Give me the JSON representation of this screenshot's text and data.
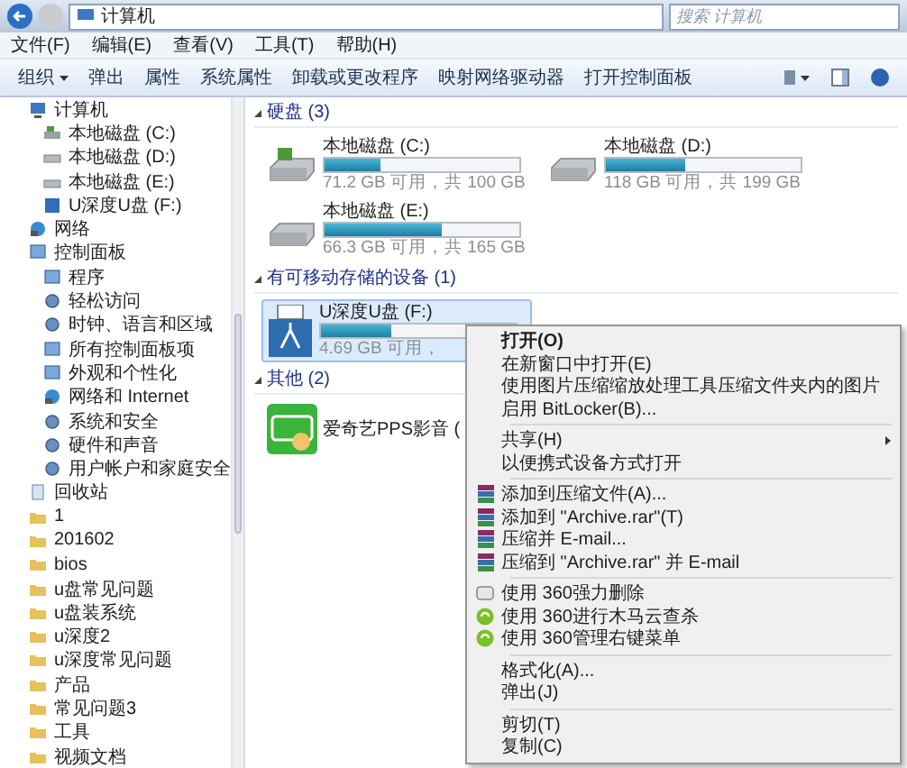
{
  "address": {
    "path": [
      "计算机"
    ],
    "search_placeholder": "搜索 计算机"
  },
  "menu": [
    "文件(F)",
    "编辑(E)",
    "查看(V)",
    "工具(T)",
    "帮助(H)"
  ],
  "toolbar": [
    {
      "label": "组织",
      "dropdown": true
    },
    {
      "label": "弹出",
      "dropdown": false
    },
    {
      "label": "属性",
      "dropdown": false
    },
    {
      "label": "系统属性",
      "dropdown": false
    },
    {
      "label": "卸载或更改程序",
      "dropdown": false
    },
    {
      "label": "映射网络驱动器",
      "dropdown": false
    },
    {
      "label": "打开控制面板",
      "dropdown": false
    }
  ],
  "sidebar": [
    {
      "label": "计算机",
      "kind": "computer",
      "children": [
        {
          "label": "本地磁盘 (C:)",
          "kind": "system-drive"
        },
        {
          "label": "本地磁盘 (D:)",
          "kind": "drive"
        },
        {
          "label": "本地磁盘 (E:)",
          "kind": "drive"
        },
        {
          "label": "U深度U盘 (F:)",
          "kind": "usb"
        }
      ]
    },
    {
      "label": "网络",
      "kind": "network"
    },
    {
      "label": "控制面板",
      "kind": "panel",
      "children": [
        {
          "label": "程序",
          "kind": "panel"
        },
        {
          "label": "轻松访问",
          "kind": "setting"
        },
        {
          "label": "时钟、语言和区域",
          "kind": "setting"
        },
        {
          "label": "所有控制面板项",
          "kind": "panel"
        },
        {
          "label": "外观和个性化",
          "kind": "panel"
        },
        {
          "label": "网络和 Internet",
          "kind": "network"
        },
        {
          "label": "系统和安全",
          "kind": "setting"
        },
        {
          "label": "硬件和声音",
          "kind": "setting"
        },
        {
          "label": "用户帐户和家庭安全",
          "kind": "setting"
        }
      ]
    },
    {
      "label": "回收站",
      "kind": "bin"
    },
    {
      "label": "1",
      "kind": "folder"
    },
    {
      "label": "201602",
      "kind": "folder"
    },
    {
      "label": "bios",
      "kind": "folder"
    },
    {
      "label": "u盘常见问题",
      "kind": "folder"
    },
    {
      "label": "u盘装系统",
      "kind": "folder"
    },
    {
      "label": "u深度2",
      "kind": "folder"
    },
    {
      "label": "u深度常见问题",
      "kind": "folder"
    },
    {
      "label": "产品",
      "kind": "folder"
    },
    {
      "label": "常见问题3",
      "kind": "folder"
    },
    {
      "label": "工具",
      "kind": "folder"
    },
    {
      "label": "视频文档",
      "kind": "folder"
    }
  ],
  "groups": [
    {
      "title": "硬盘 (3)",
      "items": [
        {
          "kind": "system-drive",
          "name": "本地磁盘 (C:)",
          "level": 0.29,
          "info": "71.2 GB 可用，共 100 GB",
          "selected": false
        },
        {
          "kind": "drive",
          "name": "本地磁盘 (D:)",
          "level": 0.41,
          "info": "118 GB 可用，共 199 GB",
          "selected": false
        },
        {
          "kind": "drive",
          "name": "本地磁盘 (E:)",
          "level": 0.6,
          "info": "66.3 GB 可用，共 165 GB",
          "selected": false
        }
      ]
    },
    {
      "title": "有可移动存储的设备 (1)",
      "items": [
        {
          "kind": "usb",
          "name": "U深度U盘 (F:)",
          "level": 0.36,
          "info": "4.69 GB 可用，",
          "selected": true
        }
      ]
    },
    {
      "title": "其他 (2)",
      "items": [
        {
          "kind": "app",
          "name": "爱奇艺PPS影音 (",
          "selected": false
        }
      ]
    }
  ],
  "context_menu": [
    {
      "kind": "plain",
      "label": "打开(O)",
      "default": true,
      "submenu": false
    },
    {
      "kind": "plain",
      "label": "在新窗口中打开(E)",
      "default": false,
      "submenu": false
    },
    {
      "kind": "plain",
      "label": "使用图片压缩缩放处理工具压缩文件夹内的图片",
      "default": false,
      "submenu": false
    },
    {
      "kind": "plain",
      "label": "启用 BitLocker(B)...",
      "default": false,
      "submenu": false
    },
    {
      "kind": "separator"
    },
    {
      "kind": "plain",
      "label": "共享(H)",
      "default": false,
      "submenu": true
    },
    {
      "kind": "plain",
      "label": "以便携式设备方式打开",
      "default": false,
      "submenu": false
    },
    {
      "kind": "separator"
    },
    {
      "kind": "archive",
      "label": "添加到压缩文件(A)...",
      "default": false,
      "submenu": false
    },
    {
      "kind": "archive",
      "label": "添加到 \"Archive.rar\"(T)",
      "default": false,
      "submenu": false
    },
    {
      "kind": "archive",
      "label": "压缩并 E-mail...",
      "default": false,
      "submenu": false
    },
    {
      "kind": "archive",
      "label": "压缩到 \"Archive.rar\" 并 E-mail",
      "default": false,
      "submenu": false
    },
    {
      "kind": "separator"
    },
    {
      "kind": "shredder",
      "label": "使用 360强力删除",
      "default": false,
      "submenu": false
    },
    {
      "kind": "scan",
      "label": "使用 360进行木马云查杀",
      "default": false,
      "submenu": false
    },
    {
      "kind": "scan",
      "label": "使用 360管理右键菜单",
      "default": false,
      "submenu": false
    },
    {
      "kind": "separator"
    },
    {
      "kind": "plain",
      "label": "格式化(A)...",
      "default": false,
      "submenu": false
    },
    {
      "kind": "plain",
      "label": "弹出(J)",
      "default": false,
      "submenu": false
    },
    {
      "kind": "separator"
    },
    {
      "kind": "plain",
      "label": "剪切(T)",
      "default": false,
      "submenu": false
    },
    {
      "kind": "plain",
      "label": "复制(C)",
      "default": false,
      "submenu": false
    }
  ]
}
